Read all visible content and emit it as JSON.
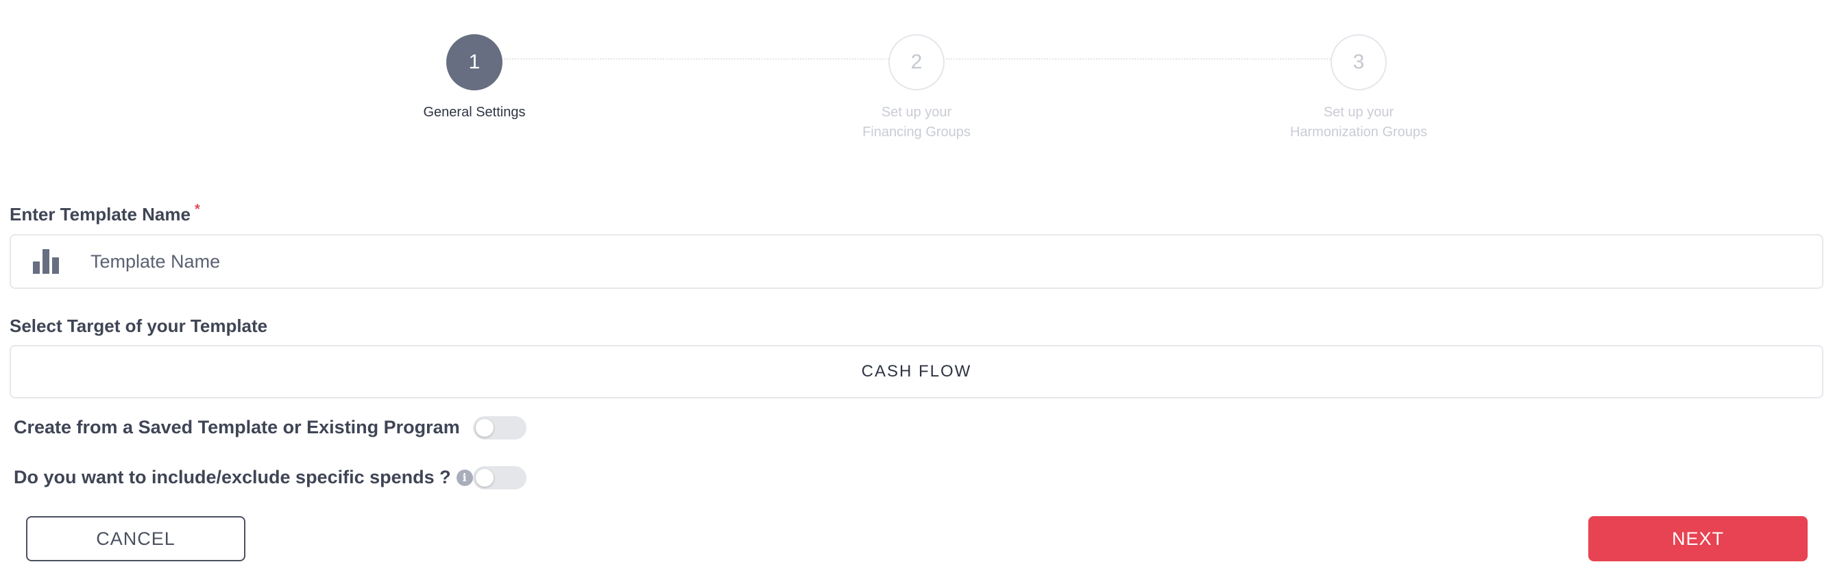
{
  "stepper": {
    "steps": [
      {
        "number": "1",
        "label_line1": "General Settings",
        "label_line2": "",
        "active": true
      },
      {
        "number": "2",
        "label_line1": "Set up your",
        "label_line2": "Financing Groups",
        "active": false
      },
      {
        "number": "3",
        "label_line1": "Set up your",
        "label_line2": "Harmonization Groups",
        "active": false
      }
    ]
  },
  "form": {
    "template_name_label": "Enter Template Name",
    "required_mark": "*",
    "template_name_placeholder": "Template Name",
    "template_name_value": "",
    "target_label": "Select Target of your Template",
    "target_value": "CASH FLOW",
    "toggle_saved_template_label": "Create from a Saved Template or Existing Program",
    "toggle_saved_template_on": false,
    "toggle_spends_label": "Do you want to include/exclude specific spends ?",
    "toggle_spends_on": false,
    "info_icon_glyph": "i"
  },
  "actions": {
    "cancel_label": "CANCEL",
    "next_label": "NEXT"
  },
  "colors": {
    "active_step": "#676e81",
    "accent_red": "#e84352",
    "text_dark": "#3f4555"
  },
  "icons": {
    "template_input_icon": "bar-chart-icon",
    "info_icon": "info-icon"
  }
}
